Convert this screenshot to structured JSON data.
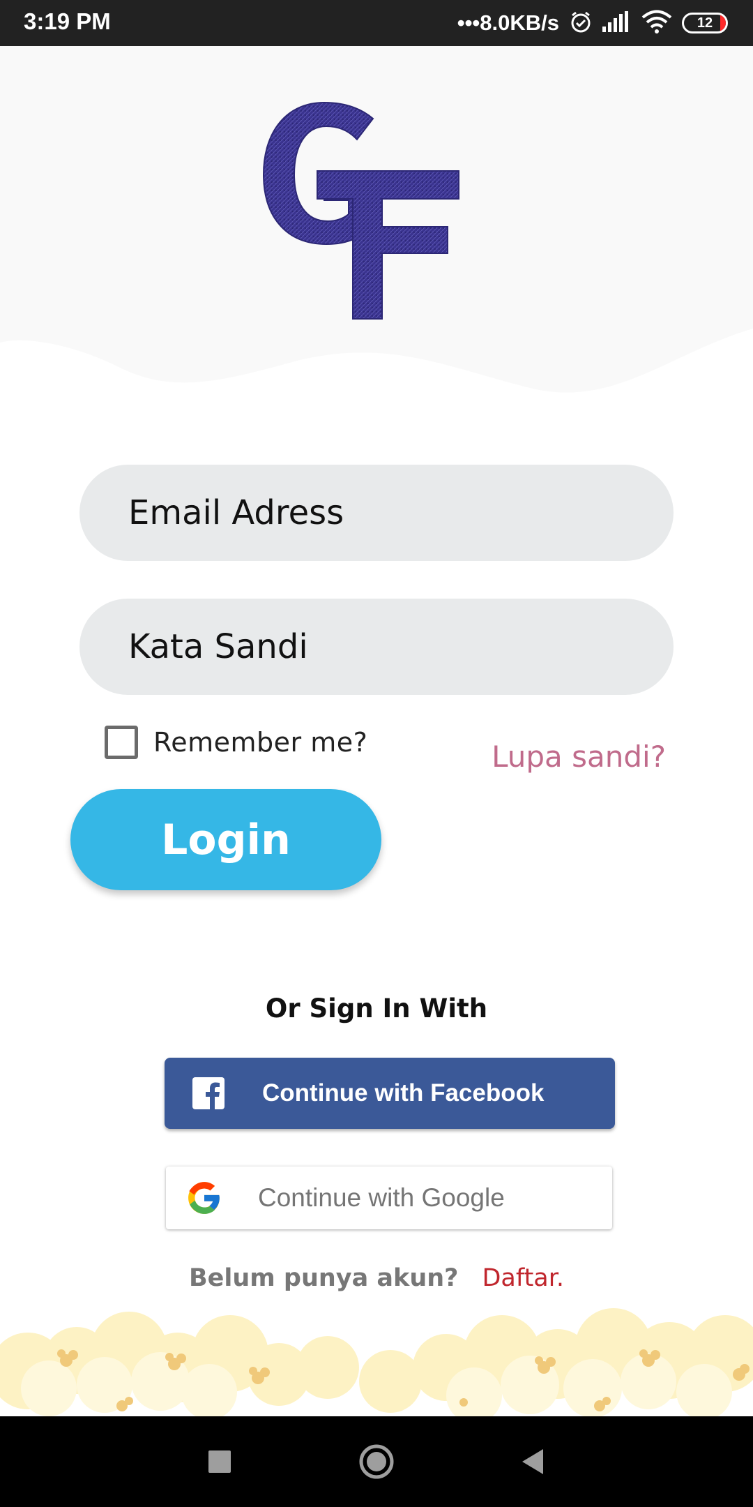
{
  "status_bar": {
    "time": "3:19 PM",
    "network_speed": "•••8.0KB/s",
    "battery_level": "12",
    "icons": [
      "alarm-icon",
      "signal-icon",
      "wifi-icon",
      "battery-icon"
    ]
  },
  "branding": {
    "logo_text": "GF",
    "logo_color": "#3a338f"
  },
  "form": {
    "email_placeholder": "Email Adress",
    "password_placeholder": "Kata Sandi",
    "remember_label": "Remember me?",
    "forgot_link": "Lupa sandi?",
    "login_button": "Login"
  },
  "social": {
    "heading": "Or Sign In With",
    "facebook_label": "Continue with Facebook",
    "google_label": "Continue with Google"
  },
  "signup": {
    "question": "Belum punya akun?",
    "link": "Daftar."
  },
  "colors": {
    "login_button": "#35b7e6",
    "facebook": "#3b5998",
    "forgot_link": "#c06b8b",
    "signup_link": "#c0262d",
    "input_background": "#e8eaeb"
  },
  "nav": {
    "icons": [
      "recent-apps-icon",
      "home-icon",
      "back-icon"
    ]
  }
}
